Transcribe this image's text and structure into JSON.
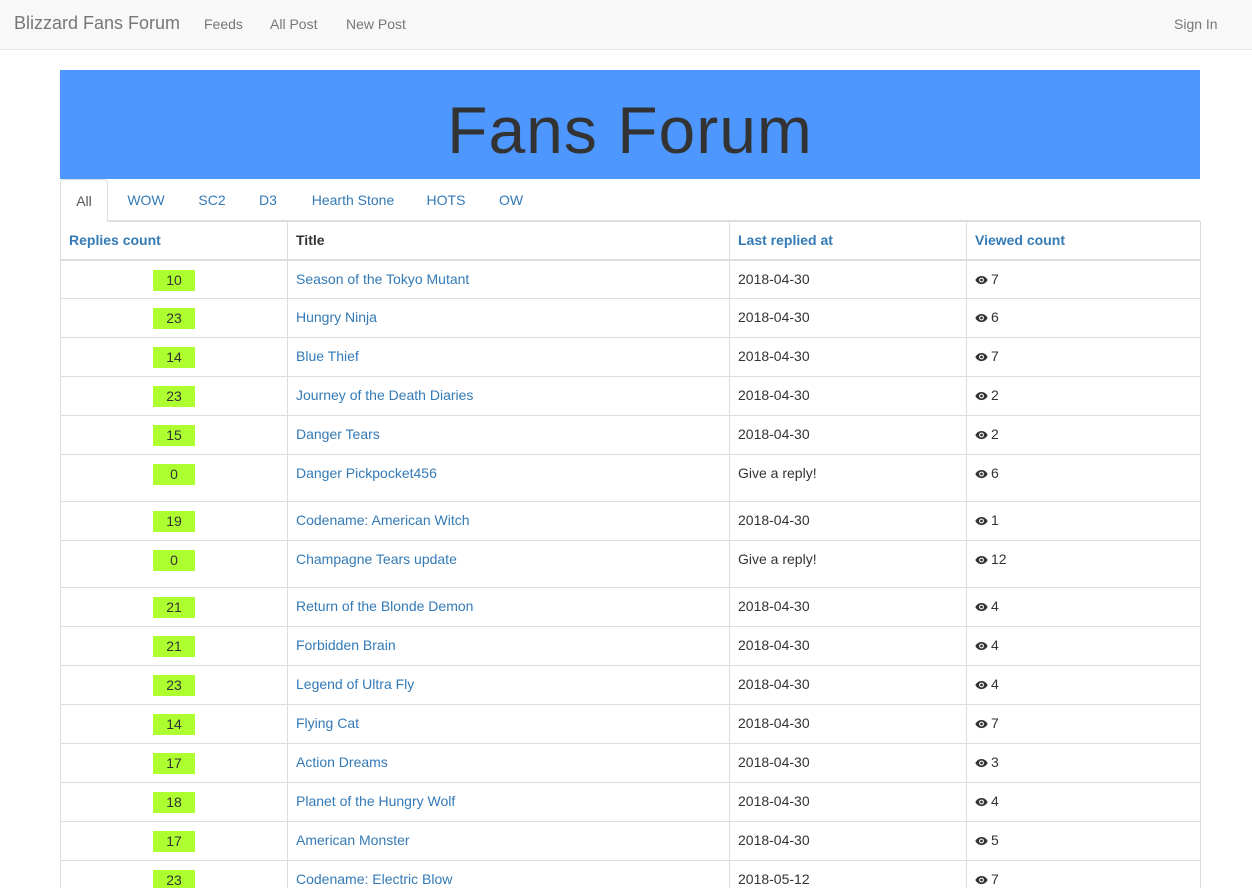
{
  "navbar": {
    "brand": "Blizzard Fans Forum",
    "links": [
      "Feeds",
      "All Post",
      "New Post"
    ],
    "sign_in": "Sign In"
  },
  "banner": {
    "title": "Fans Forum"
  },
  "tabs": [
    "All",
    "WOW",
    "SC2",
    "D3",
    "Hearth Stone",
    "HOTS",
    "OW"
  ],
  "active_tab": "All",
  "table": {
    "headers": {
      "replies": "Replies count",
      "title": "Title",
      "last_replied": "Last replied at",
      "viewed": "Viewed count"
    },
    "rows": [
      {
        "replies": "10",
        "title": "Season of the Tokyo Mutant",
        "last": "2018-04-30",
        "views": "7"
      },
      {
        "replies": "23",
        "title": "Hungry Ninja",
        "last": "2018-04-30",
        "views": "6"
      },
      {
        "replies": "14",
        "title": "Blue Thief",
        "last": "2018-04-30",
        "views": "7"
      },
      {
        "replies": "23",
        "title": "Journey of the Death Diaries",
        "last": "2018-04-30",
        "views": "2"
      },
      {
        "replies": "15",
        "title": "Danger Tears",
        "last": "2018-04-30",
        "views": "2"
      },
      {
        "replies": "0",
        "title": "Danger Pickpocket456",
        "last": "Give a reply!",
        "views": "6"
      },
      {
        "replies": "19",
        "title": "Codename: American Witch",
        "last": "2018-04-30",
        "views": "1"
      },
      {
        "replies": "0",
        "title": "Champagne Tears update",
        "last": "Give a reply!",
        "views": "12"
      },
      {
        "replies": "21",
        "title": "Return of the Blonde Demon",
        "last": "2018-04-30",
        "views": "4"
      },
      {
        "replies": "21",
        "title": "Forbidden Brain",
        "last": "2018-04-30",
        "views": "4"
      },
      {
        "replies": "23",
        "title": "Legend of Ultra Fly",
        "last": "2018-04-30",
        "views": "4"
      },
      {
        "replies": "14",
        "title": "Flying Cat",
        "last": "2018-04-30",
        "views": "7"
      },
      {
        "replies": "17",
        "title": "Action Dreams",
        "last": "2018-04-30",
        "views": "3"
      },
      {
        "replies": "18",
        "title": "Planet of the Hungry Wolf",
        "last": "2018-04-30",
        "views": "4"
      },
      {
        "replies": "17",
        "title": "American Monster",
        "last": "2018-04-30",
        "views": "5"
      },
      {
        "replies": "23",
        "title": "Codename: Electric Blow",
        "last": "2018-05-12",
        "views": "7"
      }
    ]
  },
  "colors": {
    "banner": "#4d97ff",
    "badge": "#adff2f",
    "link": "#337ab7"
  },
  "icons": {
    "views": "eye-icon"
  }
}
